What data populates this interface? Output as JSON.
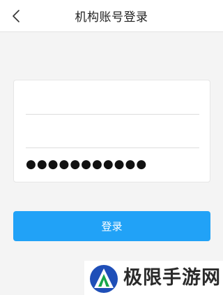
{
  "header": {
    "title": "机构账号登录",
    "back_icon": "chevron-left-icon"
  },
  "form": {
    "account_value": "",
    "code_value": "",
    "password_masked": "●●●●●●●●●●●"
  },
  "login_button": {
    "label": "登录"
  },
  "watermark": {
    "text": "极限手游网",
    "logo_icon": "triangle-logo-icon"
  },
  "colors": {
    "accent": "#21a2f7",
    "background": "#f4f4f4",
    "logo_blue": "#1f4fb8",
    "logo_green": "#18a64a"
  }
}
